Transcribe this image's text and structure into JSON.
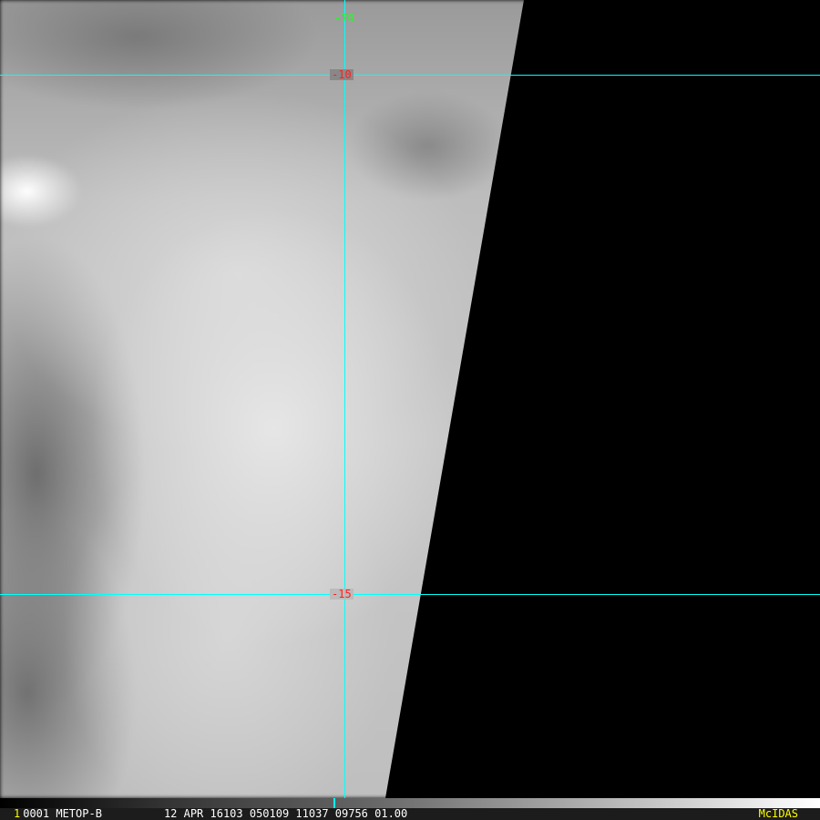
{
  "overlay": {
    "grid_color": "#00ffff",
    "labels": {
      "top": "-70",
      "lat_10": "-10",
      "lat_15": "-15"
    }
  },
  "status_bar": {
    "frame_number": "1",
    "frame_info": "0001 METOP-B",
    "date_info": "12 APR 16103 050109 11037 09756 01.00",
    "brand": "McIDAS"
  }
}
